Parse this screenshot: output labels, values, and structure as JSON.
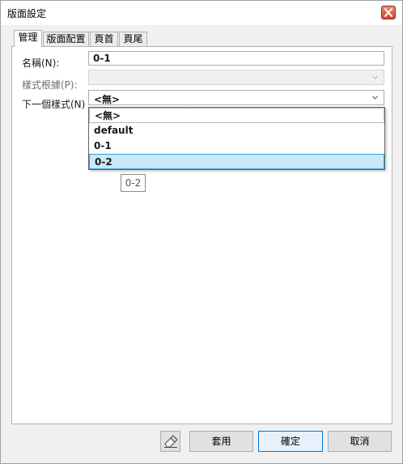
{
  "window": {
    "title": "版面設定"
  },
  "tabs": [
    "管理",
    "版面配置",
    "頁首",
    "頁尾"
  ],
  "form": {
    "name_label": "名稱(N):",
    "name_value": "0-1",
    "based_on_label": "樣式根據(P):",
    "based_on_value": "",
    "next_style_label": "下一個樣式(N)",
    "next_style_value": "<無>"
  },
  "dropdown": {
    "options": [
      "<無>",
      "default",
      "0-1",
      "0-2"
    ],
    "selected_index": 3
  },
  "tooltip": "0-2",
  "buttons": {
    "clear_icon": "eraser-icon",
    "apply": "套用",
    "ok": "確定",
    "cancel": "取消"
  },
  "colors": {
    "selection_bg": "#cbe8f6",
    "selection_border": "#26a0da",
    "default_button_border": "#0078d7",
    "close_button": "#c94a33"
  }
}
